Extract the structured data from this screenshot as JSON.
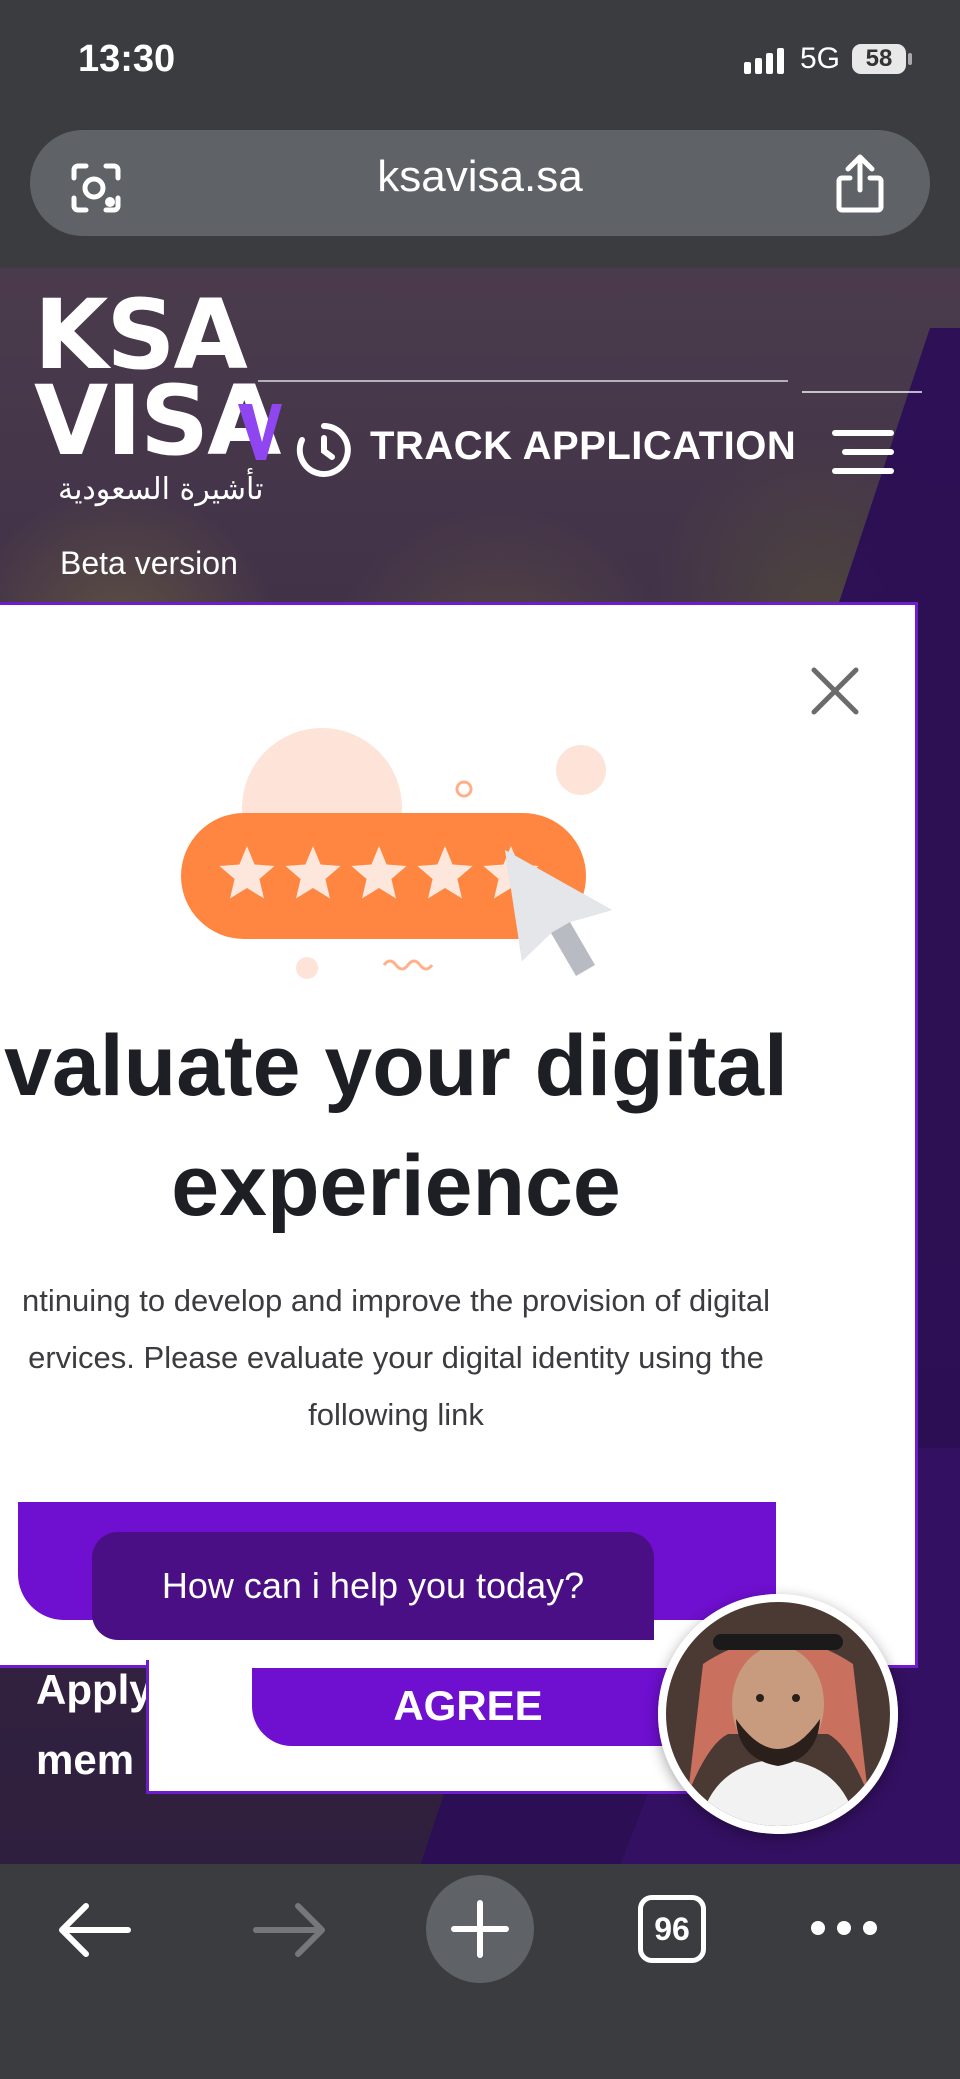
{
  "status_bar": {
    "time": "13:30",
    "network": "5G",
    "battery": "58"
  },
  "browser": {
    "url": "ksavisa.sa",
    "tab_count": "96"
  },
  "site": {
    "logo_line1": "KSA",
    "logo_line2": "VISA",
    "logo_arabic": "تأشيرة السعودية",
    "beta_label": "Beta version",
    "track_label": "TRACK APPLICATION",
    "background_text": [
      "Apply",
      "mem"
    ]
  },
  "dialog": {
    "rating_stars": 5,
    "heading_line1": "valuate your digital",
    "heading_line2": "experience",
    "description_line1": "ntinuing to develop and improve the provision of digital",
    "description_line2": "ervices. Please evaluate your digital identity using the",
    "description_line3": "following link",
    "agree_label": "AGREE"
  },
  "chat": {
    "prompt": "How can i help you today?"
  },
  "colors": {
    "brand_purple": "#6f0fcf",
    "accent_orange": "#ff8640",
    "chat_bg": "#4a0f84"
  }
}
